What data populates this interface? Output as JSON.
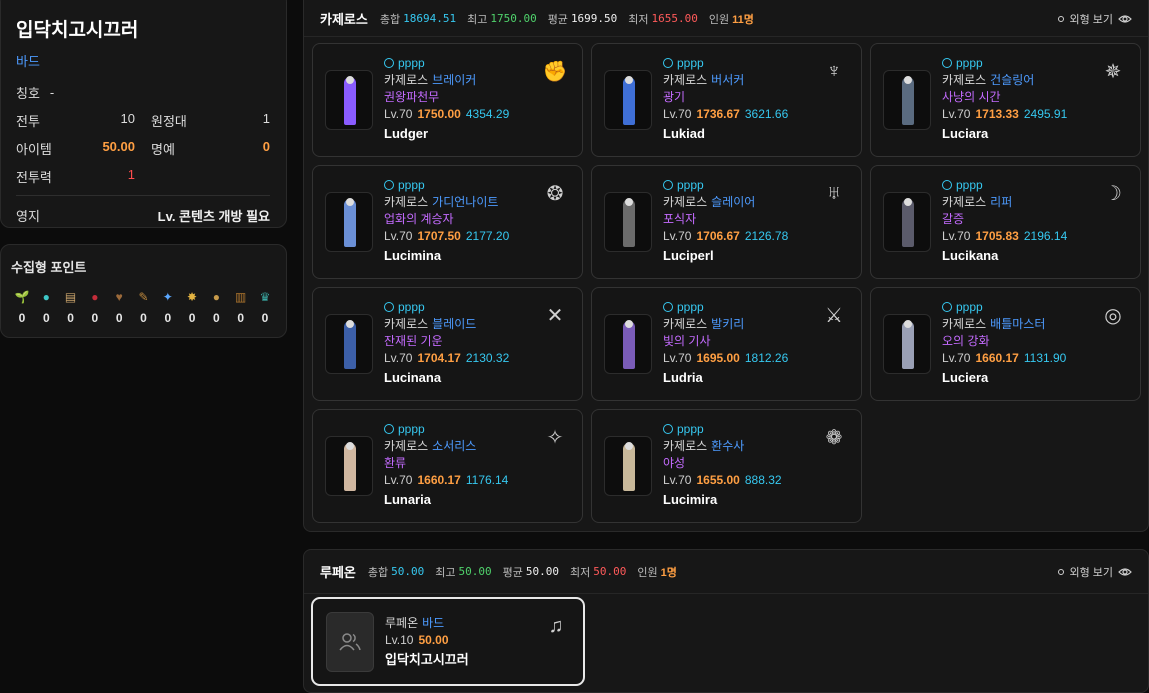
{
  "profile": {
    "name": "입닥치고시끄러",
    "class": "바드",
    "title_label": "칭호",
    "title_value": "-",
    "combat_label": "전투",
    "combat_value": "10",
    "expedition_label": "원정대",
    "expedition_value": "1",
    "item_label": "아이템",
    "item_value": "50.00",
    "honor_label": "명예",
    "honor_value": "0",
    "power_label": "전투력",
    "power_value": "1",
    "domain_label": "영지",
    "domain_value": "Lv. 콘텐츠 개방 필요"
  },
  "collect": {
    "title": "수집형 포인트",
    "items": [
      {
        "icon": "sprout-icon",
        "glyph": "🌱",
        "color": "#7a9d2e",
        "count": "0"
      },
      {
        "icon": "island-heart-icon",
        "glyph": "●",
        "color": "#3ec7c7",
        "count": "0"
      },
      {
        "icon": "map-icon",
        "glyph": "▤",
        "color": "#c9a36b",
        "count": "0"
      },
      {
        "icon": "mokoko-seed-icon",
        "glyph": "●",
        "color": "#c42d3a",
        "count": "0"
      },
      {
        "icon": "giant-heart-icon",
        "glyph": "♥",
        "color": "#9c6a3a",
        "count": "0"
      },
      {
        "icon": "art-icon",
        "glyph": "✎",
        "color": "#c08a3e",
        "count": "0"
      },
      {
        "icon": "voyage-icon",
        "glyph": "✦",
        "color": "#5aa7ff",
        "count": "0"
      },
      {
        "icon": "star-icon",
        "glyph": "✸",
        "color": "#e3b341",
        "count": "0"
      },
      {
        "icon": "orb-icon",
        "glyph": "●",
        "color": "#c79a4a",
        "count": "0"
      },
      {
        "icon": "book-icon",
        "glyph": "▥",
        "color": "#b0772e",
        "count": "0"
      },
      {
        "icon": "emblem-icon",
        "glyph": "♛",
        "color": "#3aa6a0",
        "count": "0"
      }
    ]
  },
  "server1": {
    "name": "카제로스",
    "total_label": "총합",
    "total": "18694.51",
    "max_label": "최고",
    "max": "1750.00",
    "avg_label": "평균",
    "avg": "1699.50",
    "min_label": "최저",
    "min": "1655.00",
    "count_label": "인원",
    "count": "11명",
    "view_label": "외형 보기",
    "characters": [
      {
        "owner": "pppp",
        "server": "카제로스",
        "class": "브레이커",
        "title": "권왕파천무",
        "level": "Lv.70",
        "item_level": "1750.00",
        "combat_power": "4354.29",
        "name": "Ludger",
        "icon": "fist-icon",
        "glyph": "✊",
        "fig_color": "#8a5cff"
      },
      {
        "owner": "pppp",
        "server": "카제로스",
        "class": "버서커",
        "title": "광기",
        "level": "Lv.70",
        "item_level": "1736.67",
        "combat_power": "3621.66",
        "name": "Lukiad",
        "icon": "berserker-icon",
        "glyph": "♆",
        "fig_color": "#3f6fd6"
      },
      {
        "owner": "pppp",
        "server": "카제로스",
        "class": "건슬링어",
        "title": "사냥의 시간",
        "level": "Lv.70",
        "item_level": "1713.33",
        "combat_power": "2495.91",
        "name": "Luciara",
        "icon": "gunslinger-icon",
        "glyph": "✵",
        "fig_color": "#5a6b80"
      },
      {
        "owner": "pppp",
        "server": "카제로스",
        "class": "가디언나이트",
        "title": "업화의 계승자",
        "level": "Lv.70",
        "item_level": "1707.50",
        "combat_power": "2177.20",
        "name": "Lucimina",
        "icon": "dragon-icon",
        "glyph": "❂",
        "fig_color": "#6a8fd6"
      },
      {
        "owner": "pppp",
        "server": "카제로스",
        "class": "슬레이어",
        "title": "포식자",
        "level": "Lv.70",
        "item_level": "1706.67",
        "combat_power": "2126.78",
        "name": "Luciperl",
        "icon": "slayer-icon",
        "glyph": "♅",
        "fig_color": "#6b6b6b"
      },
      {
        "owner": "pppp",
        "server": "카제로스",
        "class": "리퍼",
        "title": "갈증",
        "level": "Lv.70",
        "item_level": "1705.83",
        "combat_power": "2196.14",
        "name": "Lucikana",
        "icon": "reaper-icon",
        "glyph": "☽",
        "fig_color": "#5b5b6b"
      },
      {
        "owner": "pppp",
        "server": "카제로스",
        "class": "블레이드",
        "title": "잔재된 기운",
        "level": "Lv.70",
        "item_level": "1704.17",
        "combat_power": "2130.32",
        "name": "Lucinana",
        "icon": "blade-icon",
        "glyph": "✕",
        "fig_color": "#3c5fa8"
      },
      {
        "owner": "pppp",
        "server": "카제로스",
        "class": "발키리",
        "title": "빛의 기사",
        "level": "Lv.70",
        "item_level": "1695.00",
        "combat_power": "1812.26",
        "name": "Ludria",
        "icon": "valkyrie-icon",
        "glyph": "⚔",
        "fig_color": "#7a5cb8"
      },
      {
        "owner": "pppp",
        "server": "카제로스",
        "class": "배틀마스터",
        "title": "오의 강화",
        "level": "Lv.70",
        "item_level": "1660.17",
        "combat_power": "1131.90",
        "name": "Luciera",
        "icon": "battlemaster-icon",
        "glyph": "◎",
        "fig_color": "#9aa0b5"
      },
      {
        "owner": "pppp",
        "server": "카제로스",
        "class": "소서리스",
        "title": "환류",
        "level": "Lv.70",
        "item_level": "1660.17",
        "combat_power": "1176.14",
        "name": "Lunaria",
        "icon": "sorceress-icon",
        "glyph": "✧",
        "fig_color": "#d0b7a0"
      },
      {
        "owner": "pppp",
        "server": "카제로스",
        "class": "환수사",
        "title": "야성",
        "level": "Lv.70",
        "item_level": "1655.00",
        "combat_power": "888.32",
        "name": "Lucimira",
        "icon": "wildsoul-icon",
        "glyph": "❁",
        "fig_color": "#c8b89a"
      }
    ]
  },
  "server2": {
    "name": "루페온",
    "total_label": "총합",
    "total": "50.00",
    "max_label": "최고",
    "max": "50.00",
    "avg_label": "평균",
    "avg": "50.00",
    "min_label": "최저",
    "min": "50.00",
    "count_label": "인원",
    "count": "1명",
    "view_label": "외형 보기",
    "character": {
      "server": "루페온",
      "class": "바드",
      "level": "Lv.10",
      "item_level": "50.00",
      "name": "입닥치고시끄러",
      "icon": "lyre-icon",
      "glyph": "♫"
    }
  }
}
